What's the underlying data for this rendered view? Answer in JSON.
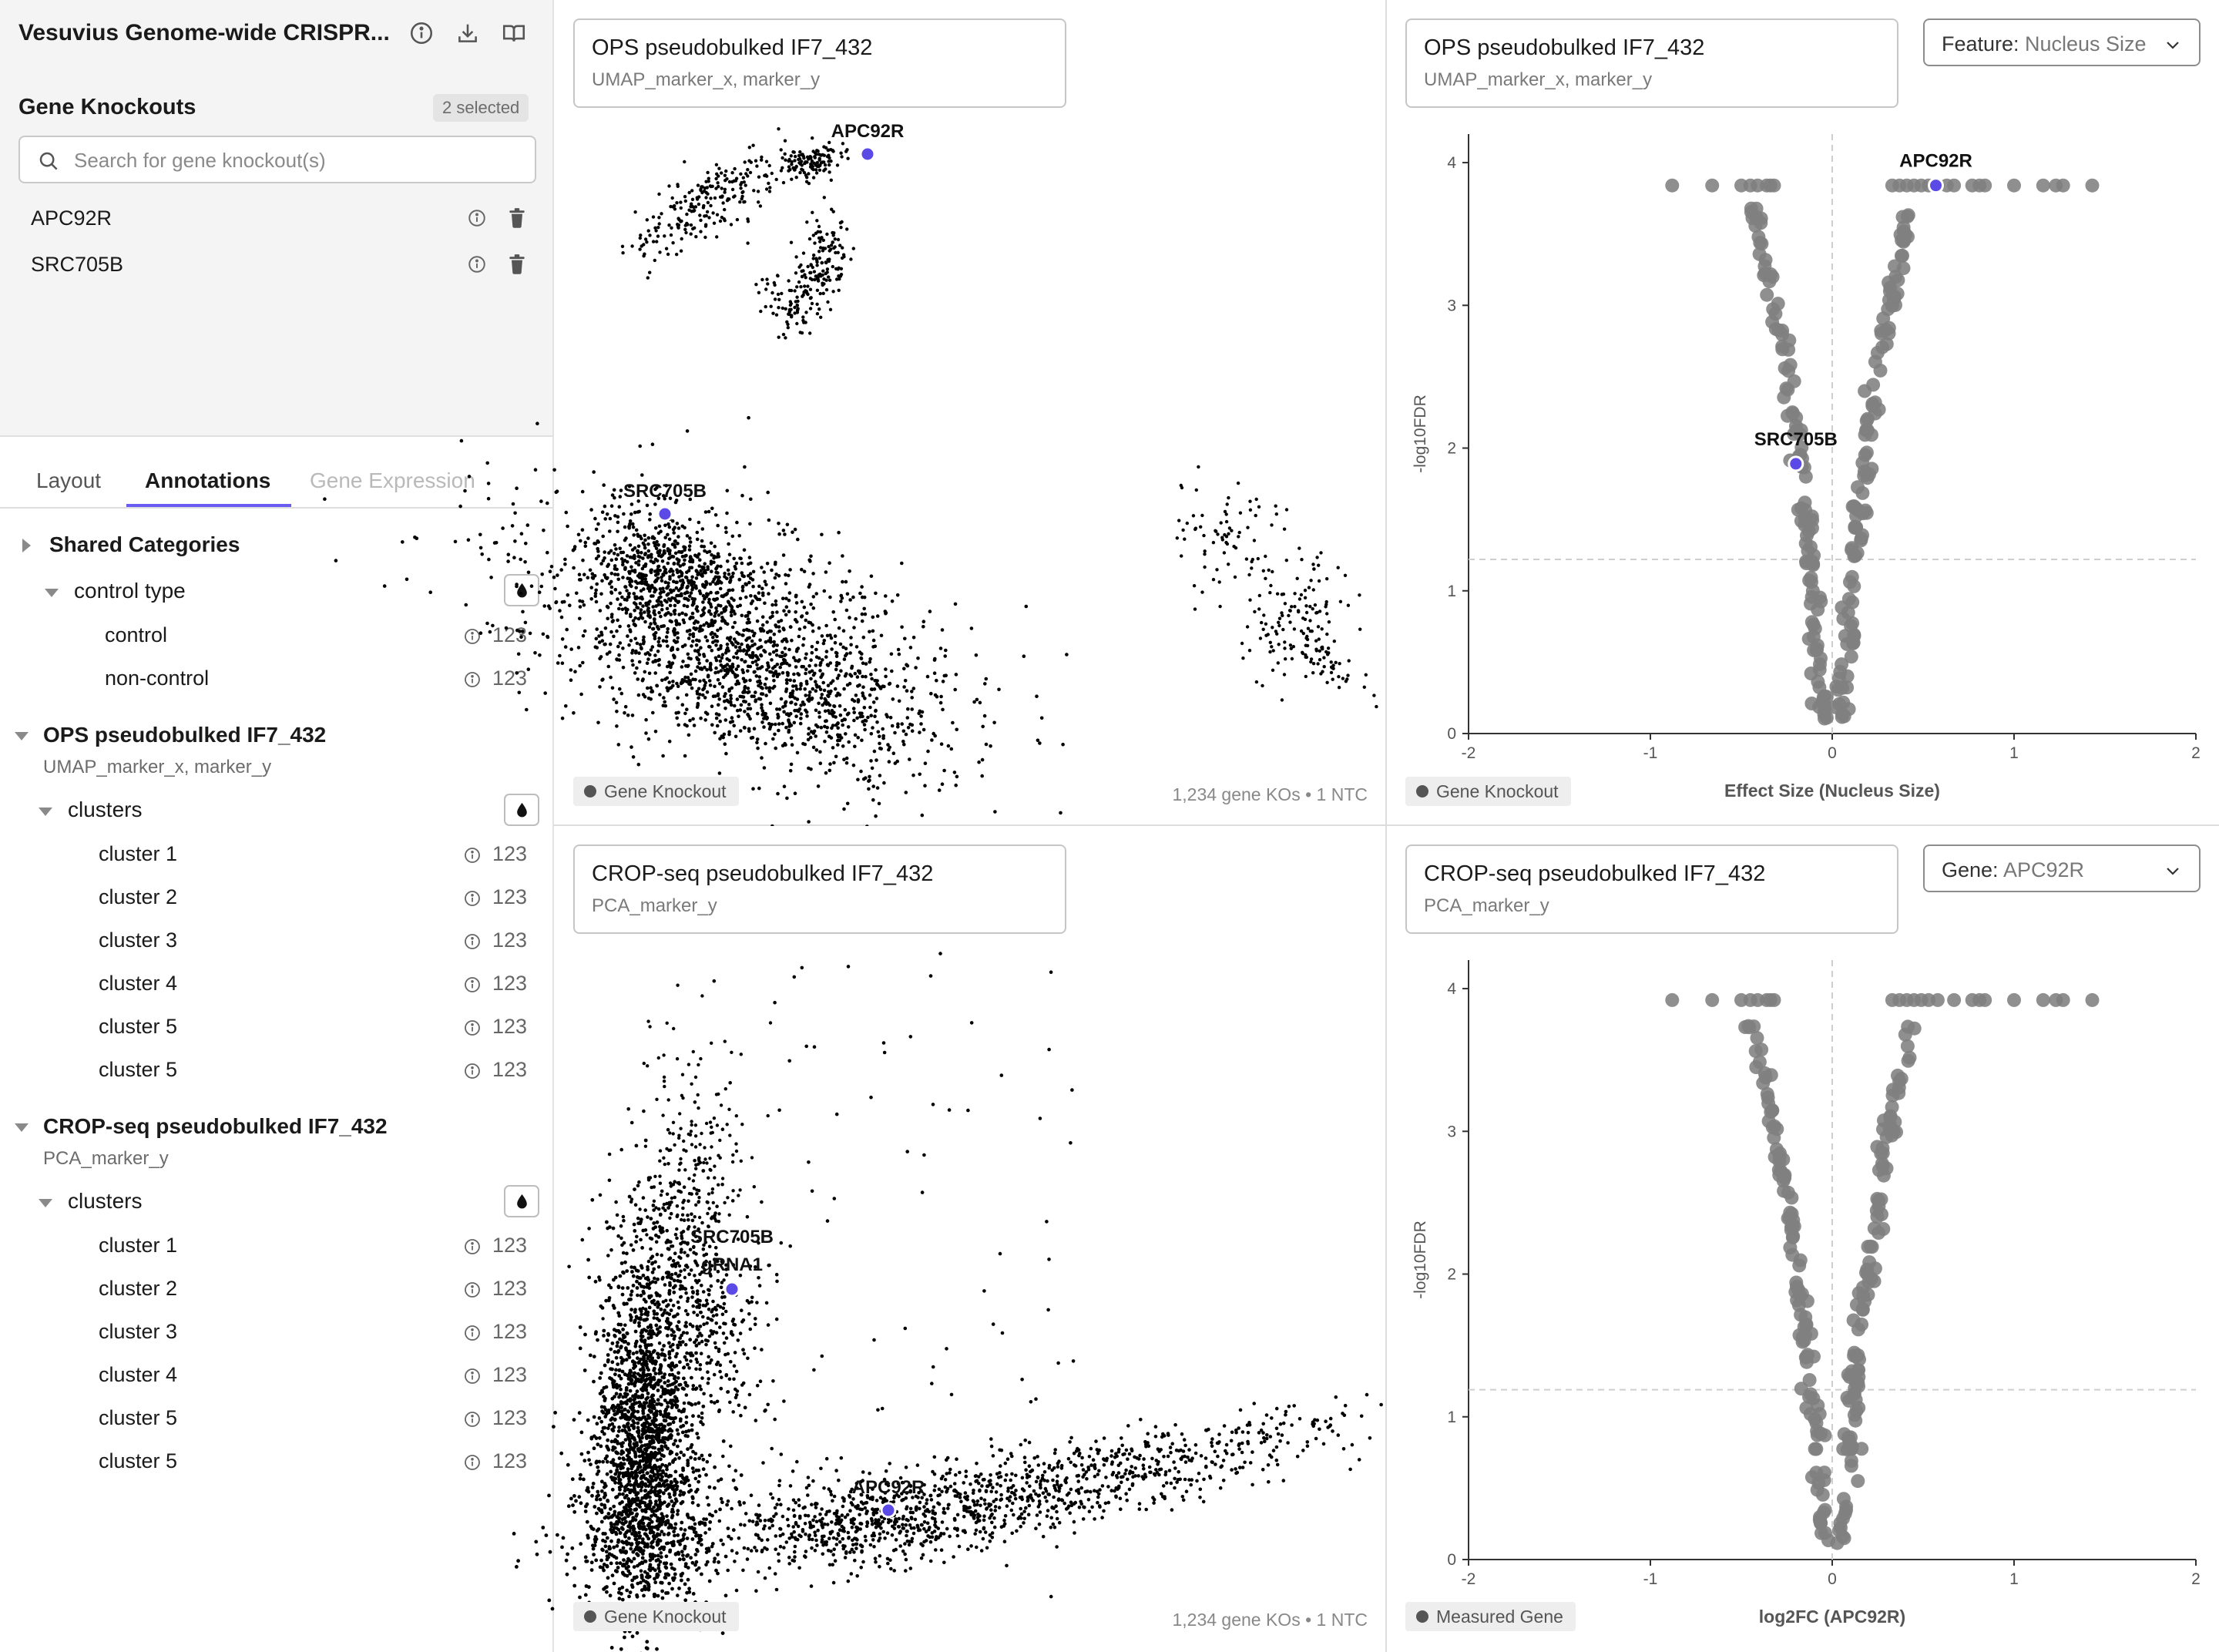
{
  "app": {
    "title": "Vesuvius Genome-wide CRISPR..."
  },
  "icons": {
    "info": "info-circle-icon",
    "download": "download-icon",
    "book": "book-open-icon",
    "search": "search-icon",
    "trash": "trash-icon",
    "color": "droplet-icon",
    "chevron": "chevron-down-icon"
  },
  "colors": {
    "accent": "#6a5cf0",
    "highlight_point": "#5b4ae6",
    "point": "#000000",
    "volcano_point": "#808080"
  },
  "gene_knockouts": {
    "title": "Gene Knockouts",
    "badge": "2 selected",
    "search_placeholder": "Search for gene knockout(s)",
    "items": [
      {
        "label": "APC92R"
      },
      {
        "label": "SRC705B"
      }
    ]
  },
  "tabs": [
    {
      "label": "Layout"
    },
    {
      "label": "Annotations"
    },
    {
      "label": "Gene Expression"
    }
  ],
  "annotations": {
    "shared": {
      "title": "Shared Categories",
      "group": "control type",
      "items": [
        {
          "label": "control",
          "count": "123"
        },
        {
          "label": "non-control",
          "count": "123"
        }
      ]
    },
    "ops": {
      "title": "OPS pseudobulked IF7_432",
      "subtitle": "UMAP_marker_x, marker_y",
      "group": "clusters",
      "items": [
        {
          "label": "cluster 1",
          "count": "123"
        },
        {
          "label": "cluster 2",
          "count": "123"
        },
        {
          "label": "cluster 3",
          "count": "123"
        },
        {
          "label": "cluster 4",
          "count": "123"
        },
        {
          "label": "cluster 5",
          "count": "123"
        },
        {
          "label": "cluster 5",
          "count": "123"
        }
      ]
    },
    "crop": {
      "title": "CROP-seq pseudobulked IF7_432",
      "subtitle": "PCA_marker_y",
      "group": "clusters",
      "items": [
        {
          "label": "cluster 1",
          "count": "123"
        },
        {
          "label": "cluster 2",
          "count": "123"
        },
        {
          "label": "cluster 3",
          "count": "123"
        },
        {
          "label": "cluster 4",
          "count": "123"
        },
        {
          "label": "cluster 5",
          "count": "123"
        },
        {
          "label": "cluster 5",
          "count": "123"
        }
      ]
    }
  },
  "panels": {
    "ops_umap": {
      "title": "OPS pseudobulked IF7_432",
      "subtitle": "UMAP_marker_x, marker_y",
      "legend": "Gene Knockout",
      "footnote": "1,234 gene KOs • 1 NTC",
      "highlights": [
        "APC92R",
        "SRC705B"
      ]
    },
    "ops_volcano": {
      "title": "OPS pseudobulked IF7_432",
      "subtitle": "UMAP_marker_x, marker_y",
      "dropdown_label": "Feature:",
      "dropdown_value": "Nucleus Size",
      "legend": "Gene Knockout"
    },
    "crop_pca": {
      "title": "CROP-seq pseudobulked IF7_432",
      "subtitle": "PCA_marker_y",
      "legend": "Gene Knockout",
      "footnote": "1,234 gene KOs • 1 NTC",
      "highlights": [
        "SRC705B",
        "gRNA1",
        "APC92R"
      ]
    },
    "crop_volcano": {
      "title": "CROP-seq pseudobulked IF7_432",
      "subtitle": "PCA_marker_y",
      "dropdown_label": "Gene:",
      "dropdown_value": "APC92R",
      "legend": "Measured Gene"
    }
  },
  "chart_data": [
    {
      "type": "scatter",
      "name_ref": "ops_umap",
      "description_ref": "UMAP embedding, ~thousands of black points in several clusters",
      "highlights": [
        {
          "label": "APC92R",
          "x": 0.43,
          "y": 0.94
        },
        {
          "label": "SRC705B",
          "x": 0.11,
          "y": 0.42
        }
      ]
    },
    {
      "type": "scatter",
      "name_ref": "ops_volcano",
      "xlabel": "Effect Size (Nucleus Size)",
      "ylabel": "-log10FDR",
      "xlim": [
        -2,
        2
      ],
      "ylim": [
        0,
        4.2
      ],
      "xticks": [
        -2,
        -1,
        0,
        1,
        2
      ],
      "yticks": [
        0,
        1,
        2,
        3,
        4
      ],
      "threshold_y": 1.22,
      "threshold_x": 0,
      "saturated_y": 3.84,
      "top_points_x": [
        -0.88,
        -0.66,
        -0.5,
        -0.45,
        -0.41,
        -0.36,
        -0.34,
        -0.32,
        0.33,
        0.37,
        0.41,
        0.45,
        0.49,
        0.53,
        0.58,
        0.63,
        0.67,
        0.77,
        0.81,
        0.84,
        1.0,
        1.16,
        1.23,
        1.27,
        1.43
      ],
      "highlights": [
        {
          "label": "APC92R",
          "x": 0.57,
          "y": 3.84
        },
        {
          "label": "SRC705B",
          "x": -0.2,
          "y": 1.89
        }
      ]
    },
    {
      "type": "scatter",
      "name_ref": "crop_pca",
      "description_ref": "PCA embedding, dense cloud with two arms",
      "highlights": [
        {
          "label": "SRC705B",
          "x": 0.2,
          "y": 0.45
        },
        {
          "label": "gRNA1",
          "x": 0.2,
          "y": 0.45
        },
        {
          "label": "APC92R",
          "x": 0.4,
          "y": 0.08
        }
      ]
    },
    {
      "type": "scatter",
      "name_ref": "crop_volcano",
      "xlabel": "log2FC (APC92R)",
      "ylabel": "-log10FDR",
      "xlim": [
        -2,
        2
      ],
      "ylim": [
        0,
        4.2
      ],
      "xticks": [
        -2,
        -1,
        0,
        1,
        2
      ],
      "yticks": [
        0,
        1,
        2,
        3,
        4
      ],
      "threshold_y": 1.19,
      "threshold_x": 0,
      "saturated_y": 3.92,
      "top_points_x": [
        -0.88,
        -0.66,
        -0.5,
        -0.45,
        -0.41,
        -0.36,
        -0.34,
        -0.32,
        0.33,
        0.37,
        0.41,
        0.45,
        0.49,
        0.53,
        0.58,
        0.67,
        0.77,
        0.81,
        0.84,
        1.0,
        1.16,
        1.23,
        1.27,
        1.43
      ],
      "highlights": []
    }
  ]
}
